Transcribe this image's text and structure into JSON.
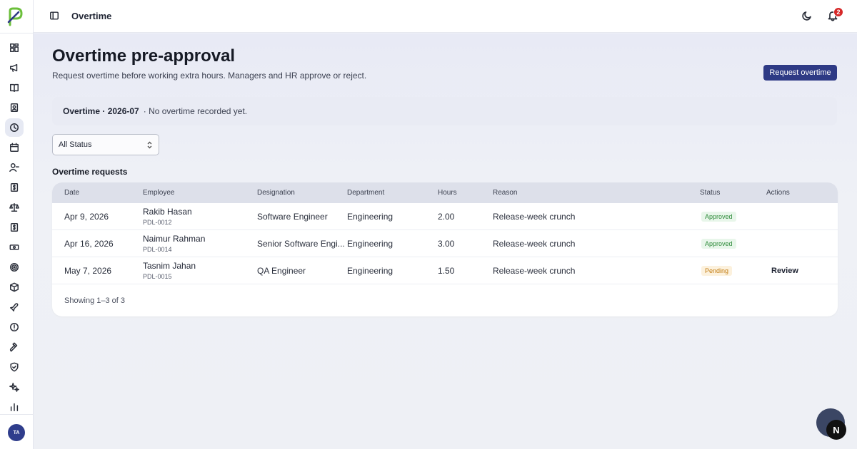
{
  "topbar": {
    "title": "Overtime",
    "notification_count": "2"
  },
  "sidebar": {
    "avatar_initials": "TA",
    "items": [
      {
        "icon": "dashboard-icon"
      },
      {
        "icon": "megaphone-icon"
      },
      {
        "icon": "book-icon"
      },
      {
        "icon": "contact-book-icon"
      },
      {
        "icon": "clock-icon",
        "active": true
      },
      {
        "icon": "calendar-icon"
      },
      {
        "icon": "user-minus-icon"
      },
      {
        "icon": "payroll-icon"
      },
      {
        "icon": "scale-icon"
      },
      {
        "icon": "dollar-icon"
      },
      {
        "icon": "cash-icon"
      },
      {
        "icon": "target-icon"
      },
      {
        "icon": "package-icon"
      },
      {
        "icon": "plane-icon"
      },
      {
        "icon": "alert-icon"
      },
      {
        "icon": "gavel-icon"
      },
      {
        "icon": "shield-icon"
      },
      {
        "icon": "sparkles-icon"
      },
      {
        "icon": "bar-chart-icon"
      }
    ]
  },
  "page": {
    "title": "Overtime pre-approval",
    "subtitle": "Request overtime before working extra hours. Managers and HR approve or reject.",
    "request_button": "Request overtime"
  },
  "summary": {
    "label": "Overtime · 2026-07",
    "note": "· No overtime recorded yet."
  },
  "filter": {
    "selected": "All Status"
  },
  "table": {
    "title": "Overtime requests",
    "columns": [
      "Date",
      "Employee",
      "Designation",
      "Department",
      "Hours",
      "Reason",
      "Status",
      "Actions"
    ],
    "rows": [
      {
        "date": "Apr 9, 2026",
        "name": "Rakib Hasan",
        "id": "PDL-0012",
        "designation": "Software Engineer",
        "department": "Engineering",
        "hours": "2.00",
        "reason": "Release-week crunch",
        "status": "Approved",
        "action": ""
      },
      {
        "date": "Apr 16, 2026",
        "name": "Naimur Rahman",
        "id": "PDL-0014",
        "designation": "Senior Software Engi...",
        "department": "Engineering",
        "hours": "3.00",
        "reason": "Release-week crunch",
        "status": "Approved",
        "action": ""
      },
      {
        "date": "May 7, 2026",
        "name": "Tasnim Jahan",
        "id": "PDL-0015",
        "designation": "QA Engineer",
        "department": "Engineering",
        "hours": "1.50",
        "reason": "Release-week crunch",
        "status": "Pending",
        "action": "Review"
      }
    ],
    "footer": "Showing 1–3 of 3"
  },
  "fab": {
    "label": "N"
  },
  "colors": {
    "primary": "#2e3a85",
    "approved": "#2e8b3a",
    "pending": "#c27c12",
    "badge": "#d62828"
  }
}
